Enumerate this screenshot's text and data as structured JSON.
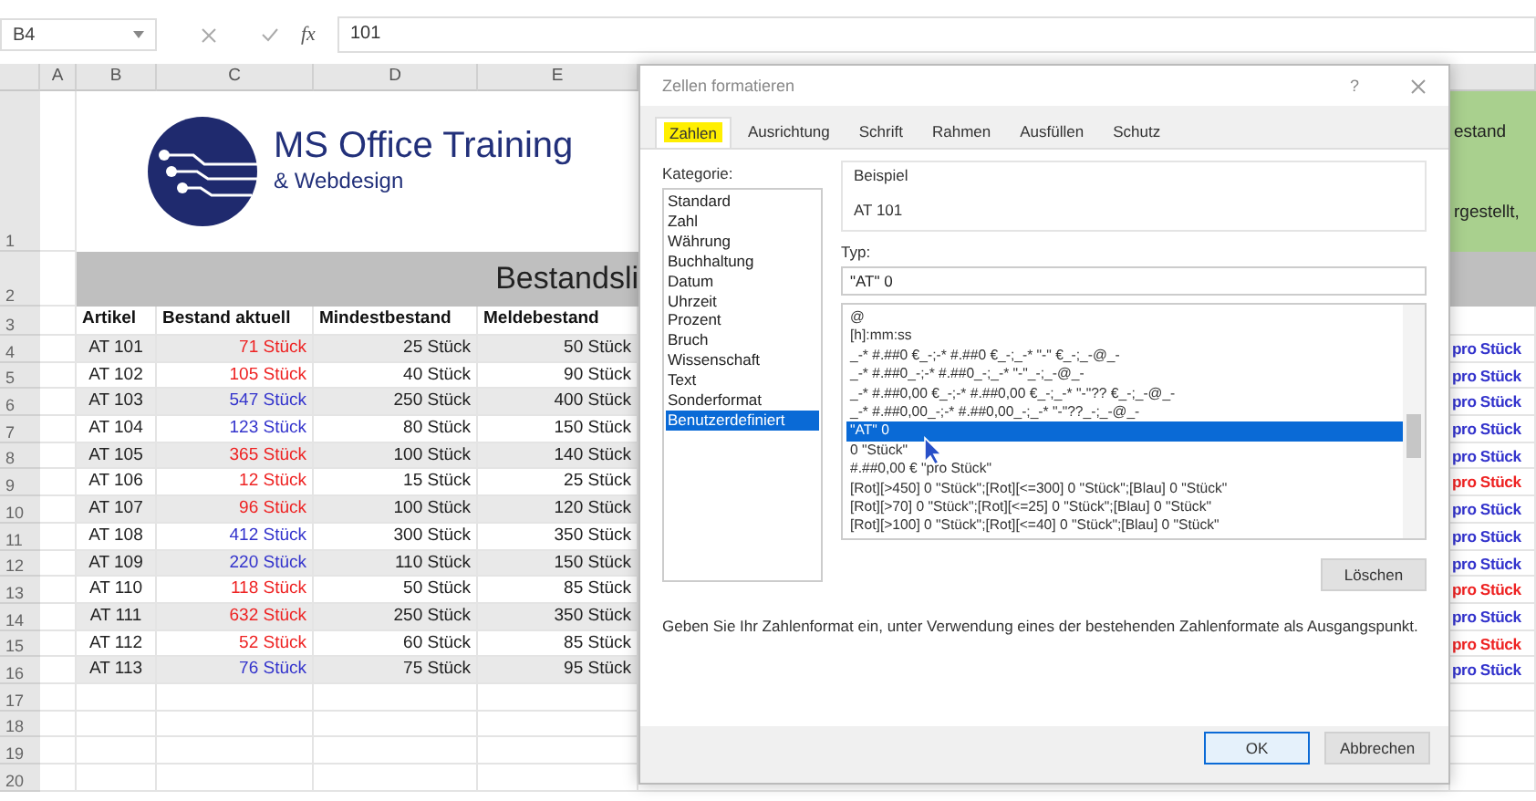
{
  "formula_bar": {
    "name_box": "B4",
    "function_label": "fx",
    "value": "101"
  },
  "columns": [
    "A",
    "B",
    "C",
    "D",
    "E"
  ],
  "logo": {
    "title": "MS Office Training",
    "subtitle": "& Webdesign"
  },
  "side_note": [
    "estand",
    "rgestellt,"
  ],
  "sheet_title": "Bestandsli",
  "headers": [
    "Artikel",
    "Bestand aktuell",
    "Mindestbestand",
    "Meldebestand"
  ],
  "rows": [
    {
      "number": "4",
      "artikel": "AT 101",
      "bestand": {
        "text": "71 Stück",
        "color": "#ee2222"
      },
      "mindest": "25 Stück",
      "melde": "50 Stück",
      "preis": {
        "text": "pro Stück",
        "color": "#3333cc"
      }
    },
    {
      "number": "5",
      "artikel": "AT 102",
      "bestand": {
        "text": "105 Stück",
        "color": "#ee2222"
      },
      "mindest": "40 Stück",
      "melde": "90 Stück",
      "preis": {
        "text": "pro Stück",
        "color": "#3333cc"
      }
    },
    {
      "number": "6",
      "artikel": "AT 103",
      "bestand": {
        "text": "547 Stück",
        "color": "#3333cc"
      },
      "mindest": "250 Stück",
      "melde": "400 Stück",
      "preis": {
        "text": "pro Stück",
        "color": "#3333cc"
      }
    },
    {
      "number": "7",
      "artikel": "AT 104",
      "bestand": {
        "text": "123 Stück",
        "color": "#3333cc"
      },
      "mindest": "80 Stück",
      "melde": "150 Stück",
      "preis": {
        "text": "pro Stück",
        "color": "#3333cc"
      }
    },
    {
      "number": "8",
      "artikel": "AT 105",
      "bestand": {
        "text": "365 Stück",
        "color": "#ee2222"
      },
      "mindest": "100 Stück",
      "melde": "140 Stück",
      "preis": {
        "text": "pro Stück",
        "color": "#3333cc"
      }
    },
    {
      "number": "9",
      "artikel": "AT 106",
      "bestand": {
        "text": "12 Stück",
        "color": "#ee2222"
      },
      "mindest": "15 Stück",
      "melde": "25 Stück",
      "preis": {
        "text": "pro Stück",
        "color": "#ee2222"
      }
    },
    {
      "number": "10",
      "artikel": "AT 107",
      "bestand": {
        "text": "96 Stück",
        "color": "#ee2222"
      },
      "mindest": "100 Stück",
      "melde": "120 Stück",
      "preis": {
        "text": "pro Stück",
        "color": "#3333cc"
      }
    },
    {
      "number": "11",
      "artikel": "AT 108",
      "bestand": {
        "text": "412 Stück",
        "color": "#3333cc"
      },
      "mindest": "300 Stück",
      "melde": "350 Stück",
      "preis": {
        "text": "pro Stück",
        "color": "#3333cc"
      }
    },
    {
      "number": "12",
      "artikel": "AT 109",
      "bestand": {
        "text": "220 Stück",
        "color": "#3333cc"
      },
      "mindest": "110 Stück",
      "melde": "150 Stück",
      "preis": {
        "text": "pro Stück",
        "color": "#3333cc"
      }
    },
    {
      "number": "13",
      "artikel": "AT 110",
      "bestand": {
        "text": "118 Stück",
        "color": "#ee2222"
      },
      "mindest": "50 Stück",
      "melde": "85 Stück",
      "preis": {
        "text": "pro Stück",
        "color": "#ee2222"
      }
    },
    {
      "number": "14",
      "artikel": "AT 111",
      "bestand": {
        "text": "632 Stück",
        "color": "#ee2222"
      },
      "mindest": "250 Stück",
      "melde": "350 Stück",
      "preis": {
        "text": "pro Stück",
        "color": "#3333cc"
      }
    },
    {
      "number": "15",
      "artikel": "AT 112",
      "bestand": {
        "text": "52 Stück",
        "color": "#ee2222"
      },
      "mindest": "60 Stück",
      "melde": "85 Stück",
      "preis": {
        "text": "pro Stück",
        "color": "#ee2222"
      }
    },
    {
      "number": "16",
      "artikel": "AT 113",
      "bestand": {
        "text": "76 Stück",
        "color": "#3333cc"
      },
      "mindest": "75 Stück",
      "melde": "95 Stück",
      "preis": {
        "text": "pro Stück",
        "color": "#3333cc"
      }
    }
  ],
  "row_numbers": [
    "1",
    "2",
    "3"
  ],
  "empty_rows": [
    "17",
    "18",
    "19",
    "20"
  ],
  "dialog": {
    "title": "Zellen formatieren",
    "help": "?",
    "tabs": [
      {
        "label": "Zahlen",
        "selected": true
      },
      {
        "label": "Ausrichtung",
        "selected": false
      },
      {
        "label": "Schrift",
        "selected": false
      },
      {
        "label": "Rahmen",
        "selected": false
      },
      {
        "label": "Ausfüllen",
        "selected": false
      },
      {
        "label": "Schutz",
        "selected": false
      }
    ],
    "category_label": "Kategorie:",
    "categories": [
      {
        "label": "Standard",
        "selected": false
      },
      {
        "label": "Zahl",
        "selected": false
      },
      {
        "label": "Währung",
        "selected": false
      },
      {
        "label": "Buchhaltung",
        "selected": false
      },
      {
        "label": "Datum",
        "selected": false
      },
      {
        "label": "Uhrzeit",
        "selected": false
      },
      {
        "label": "Prozent",
        "selected": false
      },
      {
        "label": "Bruch",
        "selected": false
      },
      {
        "label": "Wissenschaft",
        "selected": false
      },
      {
        "label": "Text",
        "selected": false
      },
      {
        "label": "Sonderformat",
        "selected": false
      },
      {
        "label": "Benutzerdefiniert",
        "selected": true
      }
    ],
    "sample_label": "Beispiel",
    "sample_value": "AT 101",
    "type_label": "Typ:",
    "type_value": "\"AT\" 0",
    "formats": [
      {
        "label": "@",
        "selected": false
      },
      {
        "label": "[h]:mm:ss",
        "selected": false
      },
      {
        "label": "_-* #.##0 €_-;-* #.##0 €_-;_-* \"-\" €_-;_-@_-",
        "selected": false
      },
      {
        "label": "_-* #.##0_-;-* #.##0_-;_-* \"-\"_-;_-@_-",
        "selected": false
      },
      {
        "label": "_-* #.##0,00 €_-;-* #.##0,00 €_-;_-* \"-\"?? €_-;_-@_-",
        "selected": false
      },
      {
        "label": "_-* #.##0,00_-;-* #.##0,00_-;_-* \"-\"??_-;_-@_-",
        "selected": false
      },
      {
        "label": "\"AT\" 0",
        "selected": true
      },
      {
        "label": "0 \"Stück\"",
        "selected": false
      },
      {
        "label": "#.##0,00 € \"pro Stück\"",
        "selected": false
      },
      {
        "label": "[Rot][>450] 0 \"Stück\";[Rot][<=300]  0 \"Stück\";[Blau]  0 \"Stück\"",
        "selected": false
      },
      {
        "label": "[Rot][>70] 0 \"Stück\";[Rot][<=25]  0 \"Stück\";[Blau]  0 \"Stück\"",
        "selected": false
      },
      {
        "label": "[Rot][>100] 0 \"Stück\";[Rot][<=40]  0 \"Stück\";[Blau]  0 \"Stück\"",
        "selected": false
      }
    ],
    "delete_button": "Löschen",
    "hint": "Geben Sie Ihr Zahlenformat ein, unter Verwendung eines der bestehenden Zahlenformate als Ausgangspunkt.",
    "ok_button": "OK",
    "cancel_button": "Abbrechen"
  }
}
